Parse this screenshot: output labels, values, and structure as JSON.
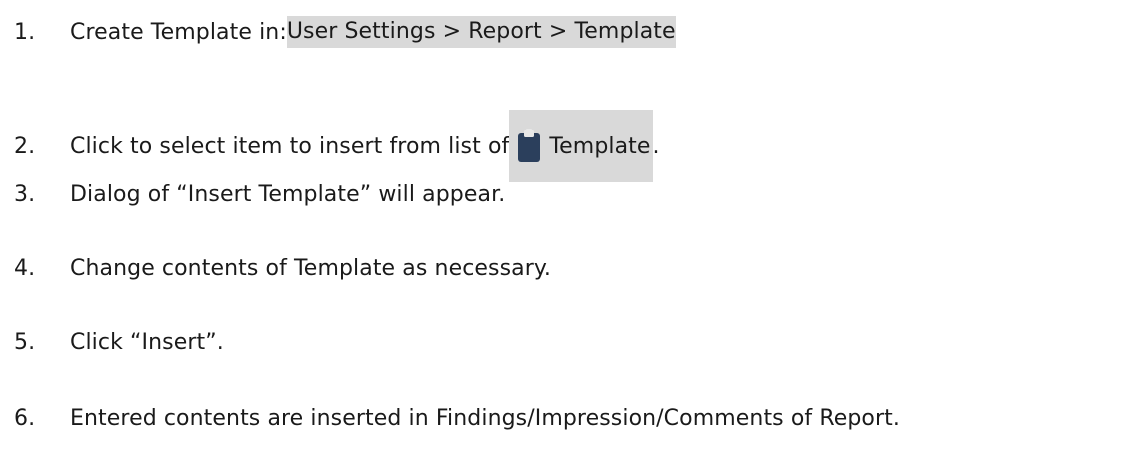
{
  "steps": [
    {
      "num": "1.",
      "text": "Create Template in: ",
      "highlight": "User Settings > Report > Template"
    },
    {
      "num": "2.",
      "text": "Click to select item to insert from list of ",
      "icon": "clipboard-icon",
      "highlight": "Template",
      "tail": "."
    },
    {
      "num": "3.",
      "text": "Dialog of “Insert Template” will appear."
    },
    {
      "num": "4.",
      "text": "Change contents of Template as necessary."
    },
    {
      "num": "5.",
      "text": "Click “Insert”."
    },
    {
      "num": "6.",
      "text": "Entered contents are inserted in Findings/Impression/Comments of Report."
    }
  ],
  "colors": {
    "highlight": "#d9d9d9",
    "icon_body": "#2b3f5c",
    "icon_clip": "#e8e8e8",
    "text": "#1a1a1a"
  }
}
